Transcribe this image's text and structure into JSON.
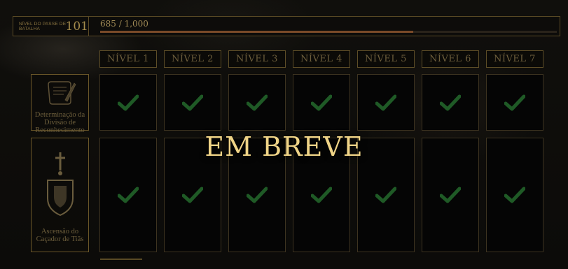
{
  "pass": {
    "level_label": "NÍVEL DO PASSE DE BATALHA",
    "level": "101",
    "xp_text": "685 / 1,000",
    "xp_progress": 0.685
  },
  "levels": [
    "NÍVEL 1",
    "NÍVEL 2",
    "NÍVEL 3",
    "NÍVEL 4",
    "NÍVEL 5",
    "NÍVEL 6",
    "NÍVEL 7"
  ],
  "tracks": [
    {
      "label": "Determinação da Divisão de Reconhecimento",
      "icon": "scroll-quill-icon",
      "claimed": [
        true,
        true,
        true,
        true,
        true,
        true,
        true
      ]
    },
    {
      "label": "Ascensão do Caçador de Tiãs",
      "icon": "cross-emblem-icon",
      "claimed": [
        true,
        true,
        true,
        true,
        true,
        true,
        true
      ]
    }
  ],
  "overlay_text": "EM BREVE",
  "colors": {
    "gold": "#f0d487",
    "check": "#1f5a26",
    "border": "#5a4a25"
  }
}
